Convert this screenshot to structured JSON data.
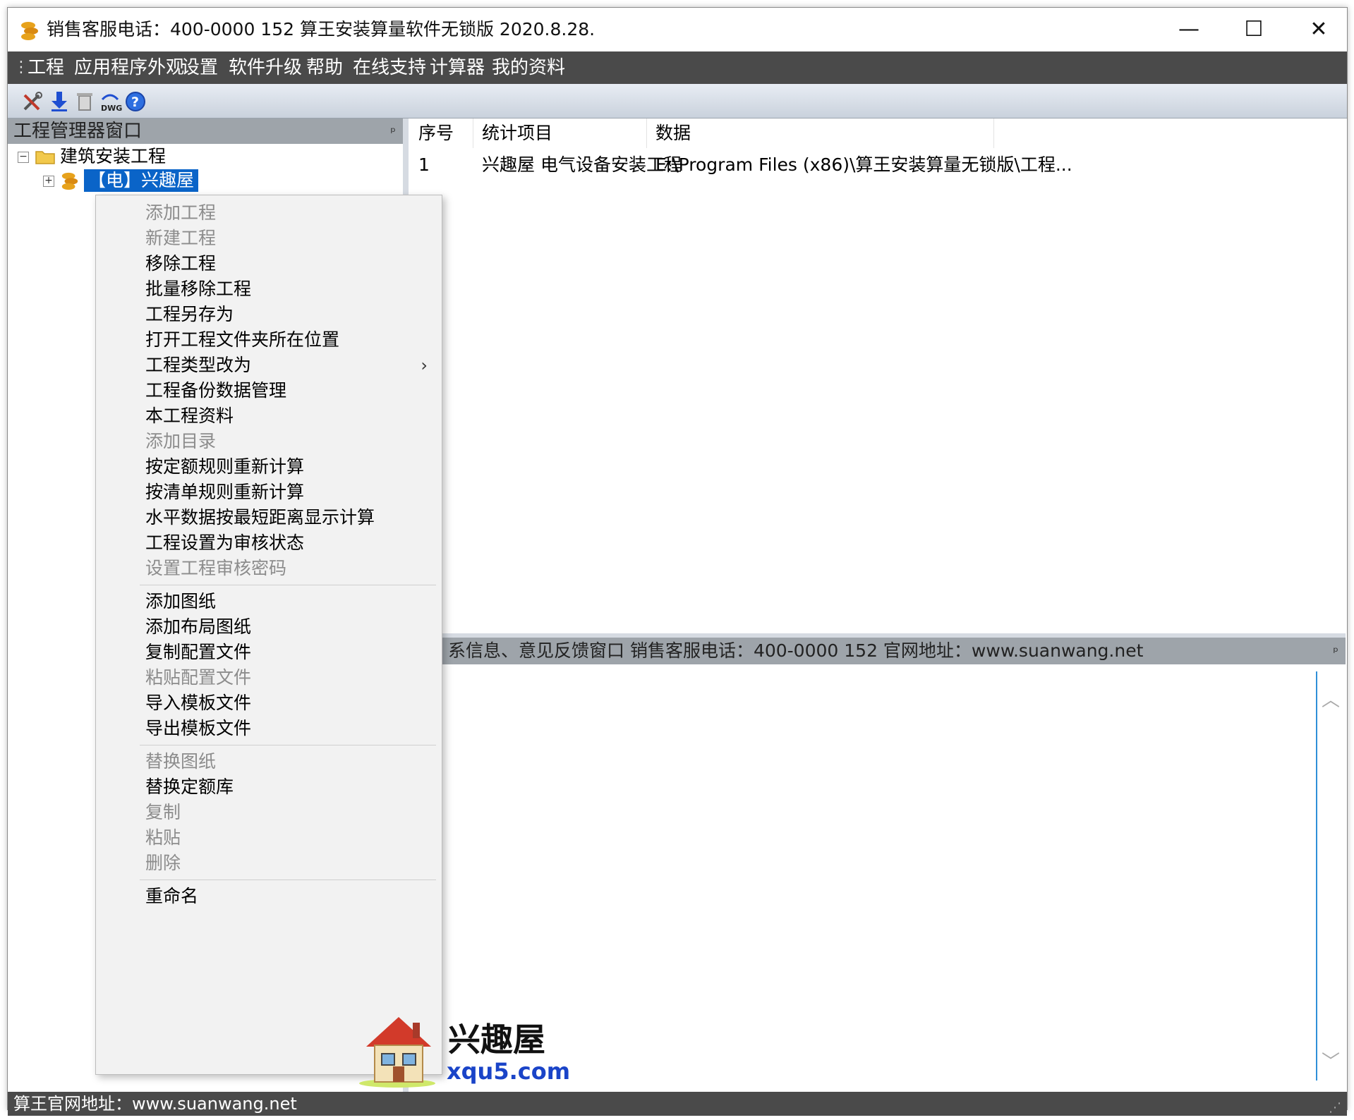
{
  "window": {
    "title": "销售客服电话：400-0000 152   算王安装算量软件无锁版 2020.8.28.",
    "min_glyph": "—",
    "max_glyph": "☐",
    "close_glyph": "✕"
  },
  "menubar": {
    "grip": "⋮",
    "items": [
      "工程",
      "应用程序外观",
      "设置",
      "软件升级",
      "帮助",
      "在线支持",
      "计算器",
      "我的资料"
    ]
  },
  "toolbar": {
    "icons": [
      "tools-icon",
      "download-arrow-icon",
      "delete-icon",
      "dwg-icon",
      "help-icon"
    ],
    "dwg_text": "DWG",
    "help_text": "?"
  },
  "project_panel": {
    "caption": "工程管理器窗口",
    "pin": "ᵖ",
    "tree": [
      {
        "label": "建筑安装工程",
        "expander": "−"
      },
      {
        "label": "【电】兴趣屋",
        "expander": "+",
        "selected": true
      }
    ]
  },
  "grid": {
    "columns": [
      "序号",
      "统计项目",
      "数据"
    ],
    "rows": [
      {
        "index": "1",
        "item": "兴趣屋 电气设备安装工程",
        "data": "E:\\Program Files (x86)\\算王安装算量无锁版\\工程..."
      }
    ]
  },
  "info_panel": {
    "caption": "系信息、意见反馈窗口  销售客服电话：400-0000 152   官网地址：www.suanwang.net",
    "pin": "ᵖ",
    "scroll_up": "︿",
    "scroll_down": "﹀"
  },
  "context_menu": {
    "items": [
      {
        "label": "添加工程",
        "disabled": true
      },
      {
        "label": "新建工程",
        "disabled": true
      },
      {
        "label": "移除工程",
        "disabled": false
      },
      {
        "label": "批量移除工程",
        "disabled": false
      },
      {
        "label": "工程另存为",
        "disabled": false
      },
      {
        "label": "打开工程文件夹所在位置",
        "disabled": false
      },
      {
        "label": "工程类型改为",
        "disabled": false,
        "submenu": true,
        "arrow": "›"
      },
      {
        "label": "工程备份数据管理",
        "disabled": false
      },
      {
        "label": "本工程资料",
        "disabled": false
      },
      {
        "label": "添加目录",
        "disabled": true
      },
      {
        "label": "按定额规则重新计算",
        "disabled": false
      },
      {
        "label": "按清单规则重新计算",
        "disabled": false
      },
      {
        "label": "水平数据按最短距离显示计算",
        "disabled": false
      },
      {
        "label": "工程设置为审核状态",
        "disabled": false
      },
      {
        "label": "设置工程审核密码",
        "disabled": true
      },
      {
        "label": "添加图纸",
        "disabled": false
      },
      {
        "label": "添加布局图纸",
        "disabled": false
      },
      {
        "label": "复制配置文件",
        "disabled": false
      },
      {
        "label": "粘贴配置文件",
        "disabled": true
      },
      {
        "label": "导入模板文件",
        "disabled": false
      },
      {
        "label": "导出模板文件",
        "disabled": false
      },
      {
        "label": "替换图纸",
        "disabled": true
      },
      {
        "label": "替换定额库",
        "disabled": false
      },
      {
        "label": "复制",
        "disabled": true
      },
      {
        "label": "粘贴",
        "disabled": true
      },
      {
        "label": "删除",
        "disabled": true
      },
      {
        "label": "重命名",
        "disabled": false
      }
    ]
  },
  "statusbar": {
    "text": "算王官网地址：www.suanwang.net",
    "grip": "⋰"
  },
  "watermark": {
    "name": "兴趣屋",
    "url": "xqu5.com"
  },
  "colors": {
    "menubar_bg": "#4a4a4a",
    "selection": "#0a64c8",
    "caption_bg": "#9ea4aa",
    "menu_bg": "#f2f2f2",
    "disabled_text": "#8c8c8c",
    "watermark_url": "#1a44c8"
  }
}
